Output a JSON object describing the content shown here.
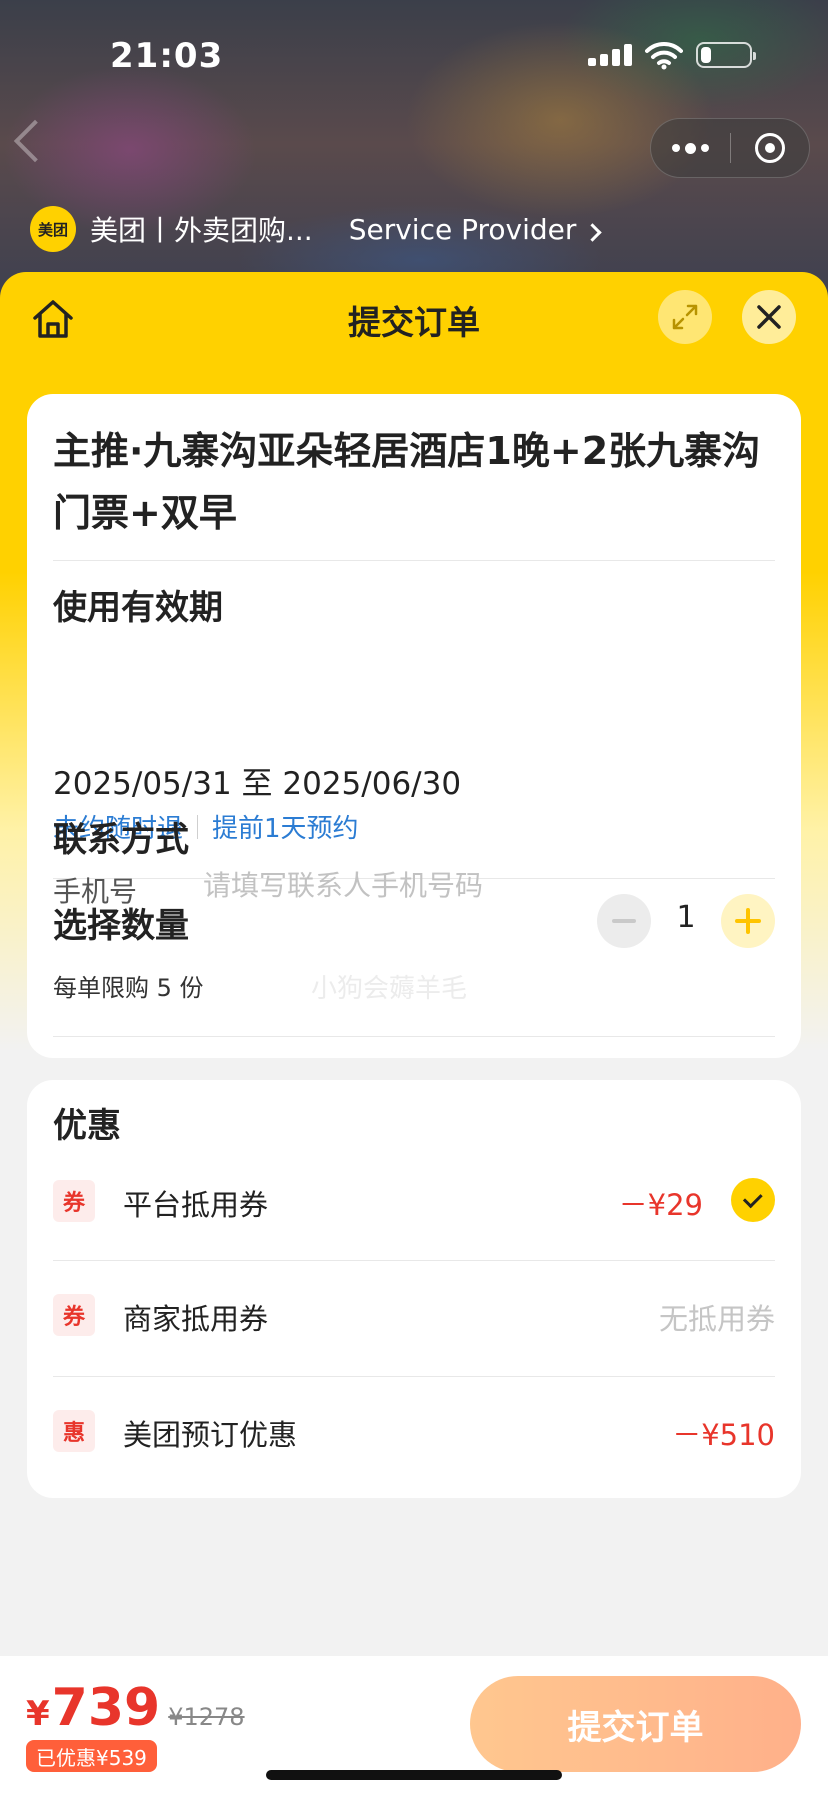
{
  "status_bar": {
    "time": "21:03"
  },
  "mini_program": {
    "name": "美团丨外卖团购...",
    "logo_text": "美团",
    "provider_link": "Service Provider"
  },
  "header": {
    "title": "提交订单"
  },
  "product": {
    "title": "主推·九寨沟亚朵轻居酒店1晚+2张九寨沟门票+双早"
  },
  "validity": {
    "label": "使用有效期",
    "range": "2025/05/31 至 2025/06/30",
    "tags": [
      "未约随时退",
      "提前1天预约"
    ]
  },
  "quantity": {
    "label": "选择数量",
    "value": "1",
    "limit_text": "每单限购 5 份",
    "watermark": "小狗会薅羊毛"
  },
  "contact": {
    "label": "联系方式",
    "field_label": "手机号",
    "placeholder": "请填写联系人手机号码"
  },
  "discounts": {
    "title": "优惠",
    "items": [
      {
        "badge": "券",
        "name": "平台抵用券",
        "amount": "－¥29",
        "checked": true
      },
      {
        "badge": "券",
        "name": "商家抵用券",
        "amount": "无抵用券"
      },
      {
        "badge": "惠",
        "name": "美团预订优惠",
        "amount": "－¥510"
      }
    ]
  },
  "footer": {
    "currency": "¥",
    "price": "739",
    "original_price": "¥1278",
    "saved_text": "已优惠¥539",
    "submit_label": "提交订单"
  },
  "colors": {
    "brand_yellow": "#ffd100",
    "price_red": "#e8352b",
    "link_blue": "#2b7cd3",
    "submit_gradient_start": "#ffc78f"
  },
  "icons": [
    "home-icon",
    "expand-icon",
    "close-icon",
    "more-icon",
    "target-icon",
    "wifi-icon",
    "battery-icon",
    "check-icon"
  ]
}
